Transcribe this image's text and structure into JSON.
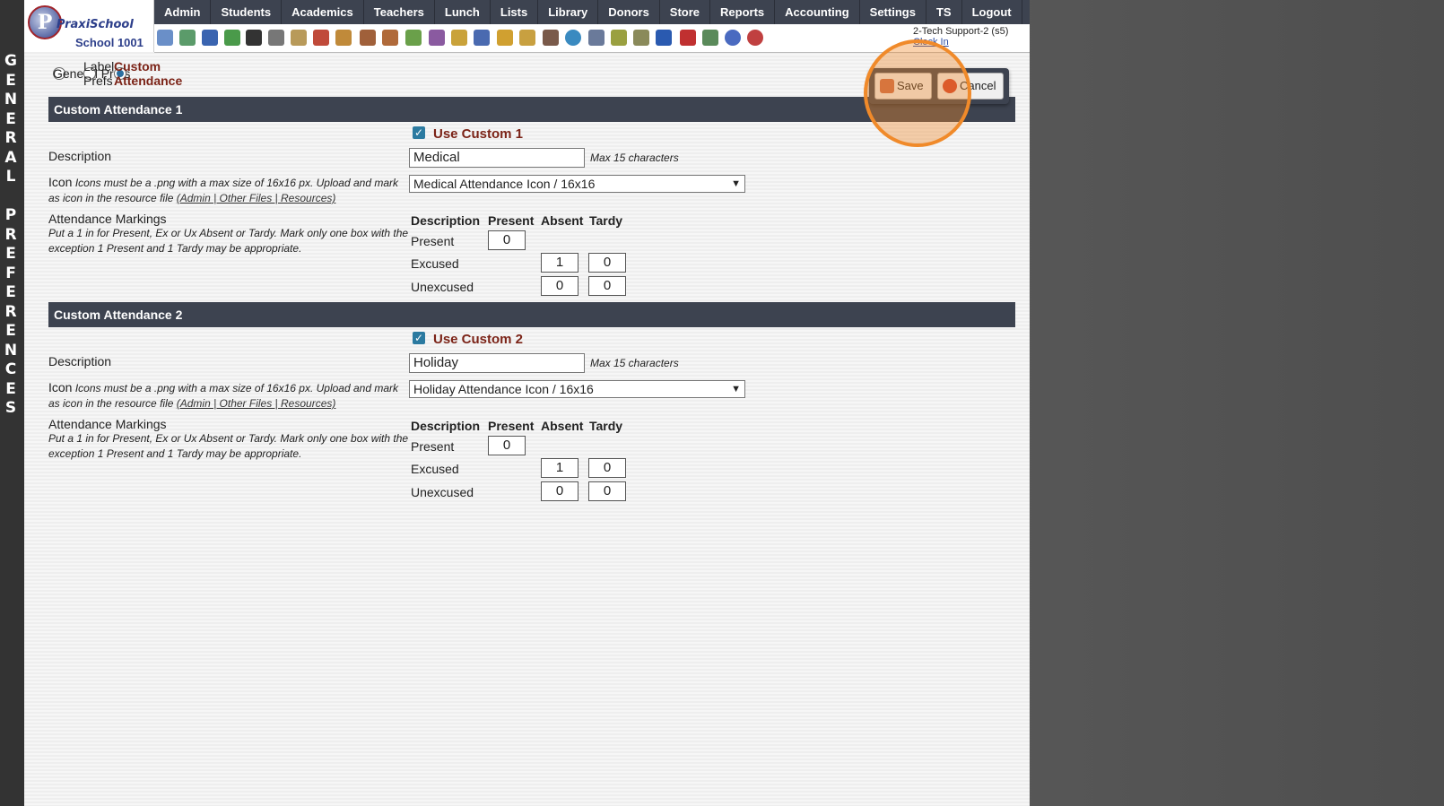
{
  "side_title": [
    "G",
    "E",
    "N",
    "E",
    "R",
    "A",
    "L",
    "",
    "P",
    "R",
    "E",
    "F",
    "E",
    "R",
    "E",
    "N",
    "C",
    "E",
    "S"
  ],
  "logo": {
    "word": "PraxiSchool",
    "school": "School 1001"
  },
  "menu": [
    "Admin",
    "Students",
    "Academics",
    "Teachers",
    "Lunch",
    "Lists",
    "Library",
    "Donors",
    "Store",
    "Reports",
    "Accounting",
    "Settings",
    "TS",
    "Logout"
  ],
  "user": {
    "name": "2-Tech Support-2 (s5)",
    "clock_link": "Clock In"
  },
  "prefs_tabs": {
    "general": "General Prefs",
    "label": "Label Prefs",
    "custom": "Custom Attendance"
  },
  "actions": {
    "save": "Save",
    "cancel": "Cancel"
  },
  "common": {
    "description_label": "Description",
    "max_note": "Max 15 characters",
    "icon_label": "Icon",
    "icon_note_prefix": "Icons must be a .png with a max size of 16x16 px. Upload and mark as icon in the resource file ",
    "icon_note_link": "(Admin | Other Files | Resources)",
    "markings_label": "Attendance Markings",
    "markings_note": "Put a 1 in for Present, Ex or Ux Absent or Tardy. Mark only one box with the exception 1 Present and 1 Tardy may be appropriate.",
    "col_description": "Description",
    "col_present": "Present",
    "col_absent": "Absent",
    "col_tardy": "Tardy",
    "row_present": "Present",
    "row_excused": "Excused",
    "row_unexcused": "Unexcused"
  },
  "sections": [
    {
      "header": "Custom Attendance 1",
      "use_label": "Use Custom 1",
      "use_checked": true,
      "description": "Medical",
      "icon_select": "Medical Attendance Icon / 16x16",
      "present": "0",
      "excused_absent": "1",
      "excused_tardy": "0",
      "unexcused_absent": "0",
      "unexcused_tardy": "0"
    },
    {
      "header": "Custom Attendance 2",
      "use_label": "Use Custom 2",
      "use_checked": true,
      "description": "Holiday",
      "icon_select": "Holiday Attendance Icon / 16x16",
      "present": "0",
      "excused_absent": "1",
      "excused_tardy": "0",
      "unexcused_absent": "0",
      "unexcused_tardy": "0"
    }
  ],
  "toolbar_icons": [
    "search-icon",
    "grid-icon",
    "email-icon",
    "chat-icon",
    "phone-icon",
    "speaker-icon",
    "report-icon",
    "calendar-icon",
    "megaphone-icon",
    "student-icon",
    "teacher-icon",
    "pencil-icon",
    "group-icon",
    "lunch-icon",
    "book-icon",
    "bell-icon",
    "transfer-icon",
    "person-icon",
    "clock-icon",
    "table-icon",
    "card-icon",
    "printer-icon",
    "ap-icon",
    "pdf-icon",
    "money-icon",
    "help-icon",
    "power-icon"
  ],
  "colors": {
    "accent": "#7b2317",
    "header_bg": "#3d4350",
    "highlight": "#f08a2a"
  }
}
